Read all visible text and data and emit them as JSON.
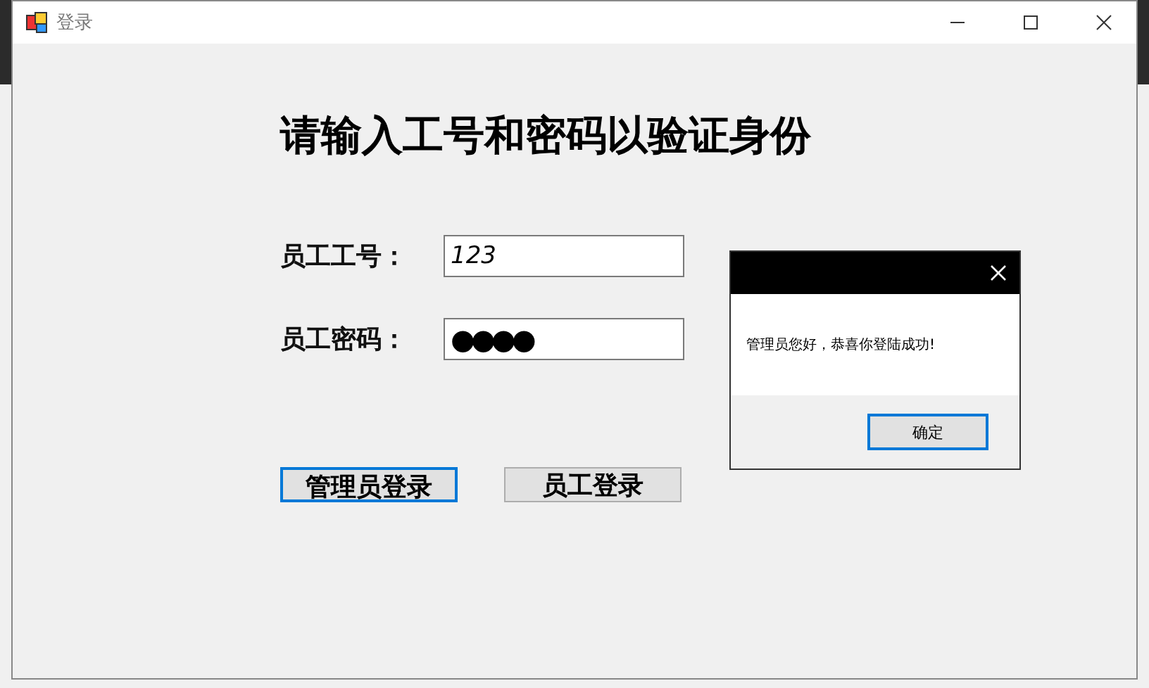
{
  "window": {
    "title": "登录"
  },
  "heading": "请输入工号和密码以验证身份",
  "fields": [
    {
      "label": "员工工号：",
      "value": "123",
      "kind": "text"
    },
    {
      "label": "员工密码：",
      "value": "●●●●",
      "kind": "password"
    }
  ],
  "buttons": [
    {
      "label": "管理员登录",
      "focused": true
    },
    {
      "label": "员工登录",
      "focused": false
    }
  ],
  "dialog": {
    "message": "管理员您好，恭喜你登陆成功!",
    "button": "确定"
  }
}
